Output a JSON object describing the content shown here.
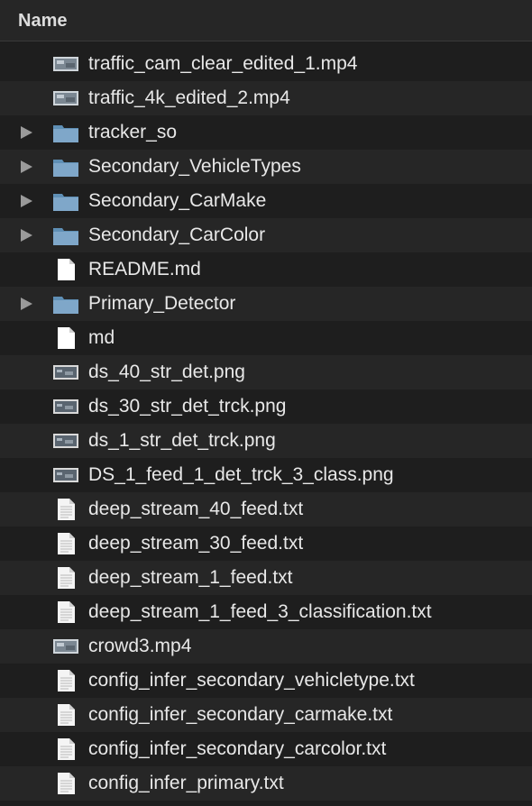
{
  "header": {
    "name_label": "Name"
  },
  "rows": [
    {
      "name": "traffic_cam_clear_edited_1.mp4",
      "icon": "video-icon",
      "expandable": false
    },
    {
      "name": "traffic_4k_edited_2.mp4",
      "icon": "video-icon",
      "expandable": false
    },
    {
      "name": "tracker_so",
      "icon": "folder-icon",
      "expandable": true
    },
    {
      "name": "Secondary_VehicleTypes",
      "icon": "folder-icon",
      "expandable": true
    },
    {
      "name": "Secondary_CarMake",
      "icon": "folder-icon",
      "expandable": true
    },
    {
      "name": "Secondary_CarColor",
      "icon": "folder-icon",
      "expandable": true
    },
    {
      "name": "README.md",
      "icon": "document-icon",
      "expandable": false
    },
    {
      "name": "Primary_Detector",
      "icon": "folder-icon",
      "expandable": true
    },
    {
      "name": "md",
      "icon": "document-icon",
      "expandable": false
    },
    {
      "name": "ds_40_str_det.png",
      "icon": "image-icon",
      "expandable": false
    },
    {
      "name": "ds_30_str_det_trck.png",
      "icon": "image-icon",
      "expandable": false
    },
    {
      "name": "ds_1_str_det_trck.png",
      "icon": "image-icon",
      "expandable": false
    },
    {
      "name": "DS_1_feed_1_det_trck_3_class.png",
      "icon": "image-icon",
      "expandable": false
    },
    {
      "name": "deep_stream_40_feed.txt",
      "icon": "text-file-icon",
      "expandable": false
    },
    {
      "name": "deep_stream_30_feed.txt",
      "icon": "text-file-icon",
      "expandable": false
    },
    {
      "name": "deep_stream_1_feed.txt",
      "icon": "text-file-icon",
      "expandable": false
    },
    {
      "name": "deep_stream_1_feed_3_classification.txt",
      "icon": "text-file-icon",
      "expandable": false
    },
    {
      "name": "crowd3.mp4",
      "icon": "video-icon",
      "expandable": false
    },
    {
      "name": "config_infer_secondary_vehicletype.txt",
      "icon": "text-file-icon",
      "expandable": false
    },
    {
      "name": "config_infer_secondary_carmake.txt",
      "icon": "text-file-icon",
      "expandable": false
    },
    {
      "name": "config_infer_secondary_carcolor.txt",
      "icon": "text-file-icon",
      "expandable": false
    },
    {
      "name": "config_infer_primary.txt",
      "icon": "text-file-icon",
      "expandable": false
    }
  ],
  "colors": {
    "background": "#1e1e1e",
    "alt_row": "#262626",
    "folder": "#7fa7c9",
    "text": "#e8e8e8"
  }
}
